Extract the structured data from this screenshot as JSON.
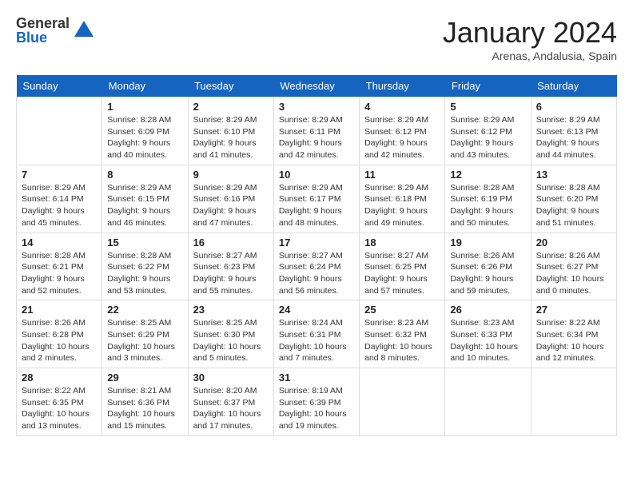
{
  "logo": {
    "general": "General",
    "blue": "Blue"
  },
  "title": "January 2024",
  "location": "Arenas, Andalusia, Spain",
  "days_of_week": [
    "Sunday",
    "Monday",
    "Tuesday",
    "Wednesday",
    "Thursday",
    "Friday",
    "Saturday"
  ],
  "weeks": [
    [
      {
        "day": "",
        "sunrise": "",
        "sunset": "",
        "daylight": ""
      },
      {
        "day": "1",
        "sunrise": "Sunrise: 8:28 AM",
        "sunset": "Sunset: 6:09 PM",
        "daylight": "Daylight: 9 hours and 40 minutes."
      },
      {
        "day": "2",
        "sunrise": "Sunrise: 8:29 AM",
        "sunset": "Sunset: 6:10 PM",
        "daylight": "Daylight: 9 hours and 41 minutes."
      },
      {
        "day": "3",
        "sunrise": "Sunrise: 8:29 AM",
        "sunset": "Sunset: 6:11 PM",
        "daylight": "Daylight: 9 hours and 42 minutes."
      },
      {
        "day": "4",
        "sunrise": "Sunrise: 8:29 AM",
        "sunset": "Sunset: 6:12 PM",
        "daylight": "Daylight: 9 hours and 42 minutes."
      },
      {
        "day": "5",
        "sunrise": "Sunrise: 8:29 AM",
        "sunset": "Sunset: 6:12 PM",
        "daylight": "Daylight: 9 hours and 43 minutes."
      },
      {
        "day": "6",
        "sunrise": "Sunrise: 8:29 AM",
        "sunset": "Sunset: 6:13 PM",
        "daylight": "Daylight: 9 hours and 44 minutes."
      }
    ],
    [
      {
        "day": "7",
        "sunrise": "Sunrise: 8:29 AM",
        "sunset": "Sunset: 6:14 PM",
        "daylight": "Daylight: 9 hours and 45 minutes."
      },
      {
        "day": "8",
        "sunrise": "Sunrise: 8:29 AM",
        "sunset": "Sunset: 6:15 PM",
        "daylight": "Daylight: 9 hours and 46 minutes."
      },
      {
        "day": "9",
        "sunrise": "Sunrise: 8:29 AM",
        "sunset": "Sunset: 6:16 PM",
        "daylight": "Daylight: 9 hours and 47 minutes."
      },
      {
        "day": "10",
        "sunrise": "Sunrise: 8:29 AM",
        "sunset": "Sunset: 6:17 PM",
        "daylight": "Daylight: 9 hours and 48 minutes."
      },
      {
        "day": "11",
        "sunrise": "Sunrise: 8:29 AM",
        "sunset": "Sunset: 6:18 PM",
        "daylight": "Daylight: 9 hours and 49 minutes."
      },
      {
        "day": "12",
        "sunrise": "Sunrise: 8:28 AM",
        "sunset": "Sunset: 6:19 PM",
        "daylight": "Daylight: 9 hours and 50 minutes."
      },
      {
        "day": "13",
        "sunrise": "Sunrise: 8:28 AM",
        "sunset": "Sunset: 6:20 PM",
        "daylight": "Daylight: 9 hours and 51 minutes."
      }
    ],
    [
      {
        "day": "14",
        "sunrise": "Sunrise: 8:28 AM",
        "sunset": "Sunset: 6:21 PM",
        "daylight": "Daylight: 9 hours and 52 minutes."
      },
      {
        "day": "15",
        "sunrise": "Sunrise: 8:28 AM",
        "sunset": "Sunset: 6:22 PM",
        "daylight": "Daylight: 9 hours and 53 minutes."
      },
      {
        "day": "16",
        "sunrise": "Sunrise: 8:27 AM",
        "sunset": "Sunset: 6:23 PM",
        "daylight": "Daylight: 9 hours and 55 minutes."
      },
      {
        "day": "17",
        "sunrise": "Sunrise: 8:27 AM",
        "sunset": "Sunset: 6:24 PM",
        "daylight": "Daylight: 9 hours and 56 minutes."
      },
      {
        "day": "18",
        "sunrise": "Sunrise: 8:27 AM",
        "sunset": "Sunset: 6:25 PM",
        "daylight": "Daylight: 9 hours and 57 minutes."
      },
      {
        "day": "19",
        "sunrise": "Sunrise: 8:26 AM",
        "sunset": "Sunset: 6:26 PM",
        "daylight": "Daylight: 9 hours and 59 minutes."
      },
      {
        "day": "20",
        "sunrise": "Sunrise: 8:26 AM",
        "sunset": "Sunset: 6:27 PM",
        "daylight": "Daylight: 10 hours and 0 minutes."
      }
    ],
    [
      {
        "day": "21",
        "sunrise": "Sunrise: 8:26 AM",
        "sunset": "Sunset: 6:28 PM",
        "daylight": "Daylight: 10 hours and 2 minutes."
      },
      {
        "day": "22",
        "sunrise": "Sunrise: 8:25 AM",
        "sunset": "Sunset: 6:29 PM",
        "daylight": "Daylight: 10 hours and 3 minutes."
      },
      {
        "day": "23",
        "sunrise": "Sunrise: 8:25 AM",
        "sunset": "Sunset: 6:30 PM",
        "daylight": "Daylight: 10 hours and 5 minutes."
      },
      {
        "day": "24",
        "sunrise": "Sunrise: 8:24 AM",
        "sunset": "Sunset: 6:31 PM",
        "daylight": "Daylight: 10 hours and 7 minutes."
      },
      {
        "day": "25",
        "sunrise": "Sunrise: 8:23 AM",
        "sunset": "Sunset: 6:32 PM",
        "daylight": "Daylight: 10 hours and 8 minutes."
      },
      {
        "day": "26",
        "sunrise": "Sunrise: 8:23 AM",
        "sunset": "Sunset: 6:33 PM",
        "daylight": "Daylight: 10 hours and 10 minutes."
      },
      {
        "day": "27",
        "sunrise": "Sunrise: 8:22 AM",
        "sunset": "Sunset: 6:34 PM",
        "daylight": "Daylight: 10 hours and 12 minutes."
      }
    ],
    [
      {
        "day": "28",
        "sunrise": "Sunrise: 8:22 AM",
        "sunset": "Sunset: 6:35 PM",
        "daylight": "Daylight: 10 hours and 13 minutes."
      },
      {
        "day": "29",
        "sunrise": "Sunrise: 8:21 AM",
        "sunset": "Sunset: 6:36 PM",
        "daylight": "Daylight: 10 hours and 15 minutes."
      },
      {
        "day": "30",
        "sunrise": "Sunrise: 8:20 AM",
        "sunset": "Sunset: 6:37 PM",
        "daylight": "Daylight: 10 hours and 17 minutes."
      },
      {
        "day": "31",
        "sunrise": "Sunrise: 8:19 AM",
        "sunset": "Sunset: 6:39 PM",
        "daylight": "Daylight: 10 hours and 19 minutes."
      },
      {
        "day": "",
        "sunrise": "",
        "sunset": "",
        "daylight": ""
      },
      {
        "day": "",
        "sunrise": "",
        "sunset": "",
        "daylight": ""
      },
      {
        "day": "",
        "sunrise": "",
        "sunset": "",
        "daylight": ""
      }
    ]
  ]
}
